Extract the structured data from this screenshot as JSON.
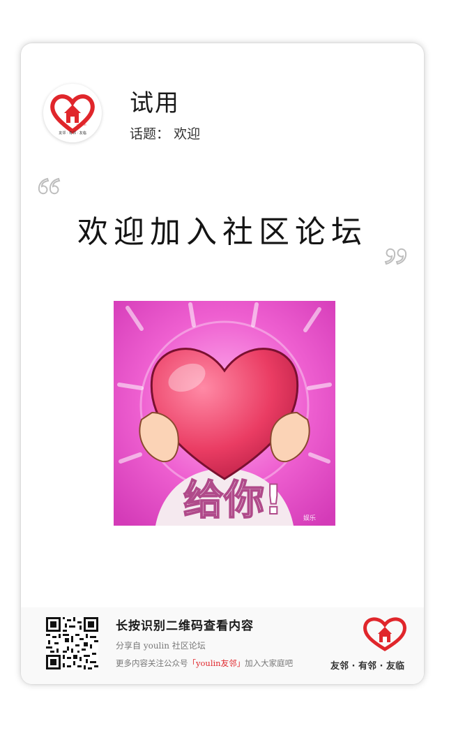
{
  "post": {
    "title": "试用",
    "topic_label": "话题：",
    "topic": "欢迎",
    "headline": "欢迎加入社区论坛"
  },
  "avatar": {
    "brand": "youlin",
    "tagline": "友邻 · 有邻 · 友临"
  },
  "meme": {
    "caption": "给你!",
    "watermark": "娱乐"
  },
  "footer": {
    "title": "长按识别二维码查看内容",
    "share": "分享自 youlin 社区论坛",
    "follow_prefix": "更多内容关注公众号",
    "follow_account": "「youlin友邻」",
    "follow_suffix": "加入大家庭吧",
    "slogan": "友邻 · 有邻 · 友临"
  },
  "colors": {
    "brand_red": "#e0262b",
    "meme_pink": "#e64fc8",
    "heart": "#e8365e"
  }
}
